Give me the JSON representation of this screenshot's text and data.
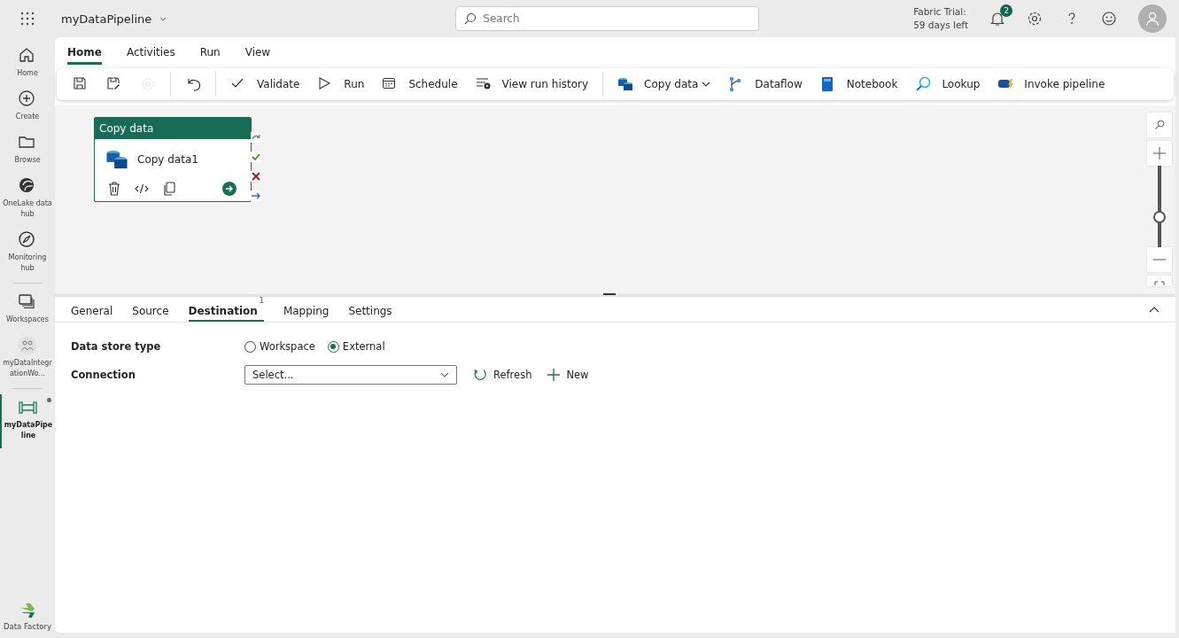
{
  "app_bar": {
    "title": "myDataPipeline",
    "search": {
      "placeholder": "Search"
    },
    "trial": [
      "Fabric Trial:",
      "59 days left"
    ],
    "notification_count": "2"
  },
  "sidebar": {
    "items": [
      {
        "label": "Home",
        "selected": false
      },
      {
        "label": "Create",
        "selected": false
      },
      {
        "label": "Browse",
        "selected": false
      },
      {
        "label": "OneLake data hub",
        "selected": false
      },
      {
        "label": "Monitoring hub",
        "selected": false
      },
      {
        "label": "Workspaces",
        "selected": false
      },
      {
        "label": "myDataIntegrationWo...",
        "selected": false
      },
      {
        "label": "myDataPipeline",
        "selected": true
      }
    ],
    "footer": "Data Factory"
  },
  "ribbon": {
    "tabs": [
      {
        "label": "Home",
        "selected": true
      },
      {
        "label": "Activities",
        "selected": false
      },
      {
        "label": "Run",
        "selected": false
      },
      {
        "label": "View",
        "selected": false
      }
    ],
    "icon_buttons": [
      {
        "disabled": false
      },
      {
        "disabled": false
      },
      {
        "disabled": true
      },
      {
        "disabled": false
      }
    ],
    "buttons": [
      {
        "label": "Validate",
        "dropdown": false
      },
      {
        "label": "Run",
        "dropdown": false
      },
      {
        "label": "Schedule",
        "dropdown": false
      },
      {
        "label": "View run history",
        "dropdown": false
      },
      {
        "label": "Copy data",
        "dropdown": true
      },
      {
        "label": "Dataflow",
        "dropdown": false
      },
      {
        "label": "Notebook",
        "dropdown": false
      },
      {
        "label": "Lookup",
        "dropdown": false
      },
      {
        "label": "Invoke pipeline",
        "dropdown": false
      }
    ]
  },
  "canvas": {
    "activity": {
      "header": "Copy data",
      "name": "Copy data1"
    },
    "zoom": {
      "level": 0.35
    }
  },
  "properties": {
    "tabs": [
      {
        "label": "General",
        "selected": false
      },
      {
        "label": "Source",
        "selected": false
      },
      {
        "label": "Destination",
        "selected": true,
        "badge": "1"
      },
      {
        "label": "Mapping",
        "selected": false
      },
      {
        "label": "Settings",
        "selected": false
      }
    ],
    "data_store_type": {
      "label": "Data store type",
      "options": [
        {
          "label": "Workspace",
          "selected": false
        },
        {
          "label": "External",
          "selected": true
        }
      ]
    },
    "connection": {
      "label": "Connection",
      "placeholder": "Select...",
      "actions": [
        "Refresh",
        "New"
      ]
    }
  }
}
